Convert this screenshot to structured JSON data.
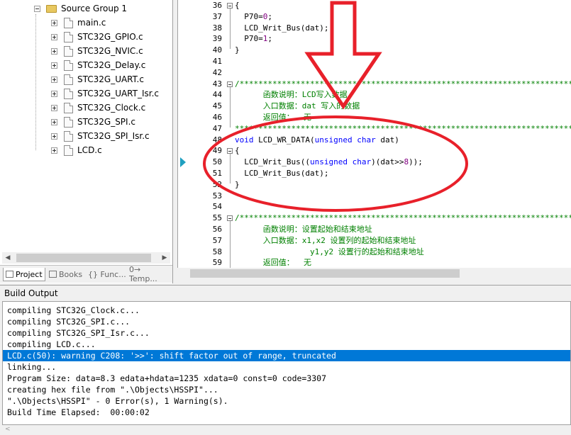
{
  "project_panel": {
    "group_label": "Source Group 1",
    "files": [
      "main.c",
      "STC32G_GPIO.c",
      "STC32G_NVIC.c",
      "STC32G_Delay.c",
      "STC32G_UART.c",
      "STC32G_UART_Isr.c",
      "STC32G_Clock.c",
      "STC32G_SPI.c",
      "STC32G_SPI_Isr.c",
      "LCD.c"
    ],
    "tabs": [
      "Project",
      "Books",
      "{} Func...",
      "0→ Temp..."
    ]
  },
  "editor": {
    "line_numbers": [
      "36",
      "37",
      "38",
      "39",
      "40",
      "41",
      "42",
      "43",
      "44",
      "45",
      "46",
      "47",
      "48",
      "49",
      "50",
      "51",
      "52",
      "53",
      "54",
      "55",
      "56",
      "57",
      "58",
      "59"
    ],
    "lines": [
      "{",
      "  P70=0;",
      "  LCD_Writ_Bus(dat);",
      "  P70=1;",
      "}",
      "",
      "",
      "/*****************************************************************************",
      "      函数说明：LCD写入数据",
      "      入口数据：dat 写入的数据",
      "      返回值：  无",
      "*****************************************************************************/",
      "void LCD_WR_DATA(unsigned char dat)",
      "{",
      "  LCD_Writ_Bus((unsigned char)(dat>>8));",
      "  LCD_Writ_Bus(dat);",
      "}",
      "",
      "",
      "/*****************************************************************************",
      "      函数说明：设置起始和结束地址",
      "      入口数据：x1,x2 设置列的起始和结束地址",
      "                y1,y2 设置行的起始和结束地址",
      "      返回值：  无"
    ]
  },
  "build_output": {
    "title": "Build Output",
    "lines": [
      "compiling STC32G_Clock.c...",
      "compiling STC32G_SPI.c...",
      "compiling STC32G_SPI_Isr.c...",
      "compiling LCD.c...",
      "LCD.c(50): warning C208: '>>': shift factor out of range, truncated",
      "linking...",
      "Program Size: data=8.3 edata+hdata=1235 xdata=0 const=0 code=3307",
      "creating hex file from \".\\Objects\\HSSPI\"...",
      "\".\\Objects\\HSSPI\" - 0 Error(s), 1 Warning(s).",
      "Build Time Elapsed:  00:00:02"
    ],
    "selected_index": 4
  },
  "colors": {
    "annotation": "#e8202a",
    "selection": "#0078d7",
    "comment": "#008000",
    "keyword": "#0000ff"
  }
}
